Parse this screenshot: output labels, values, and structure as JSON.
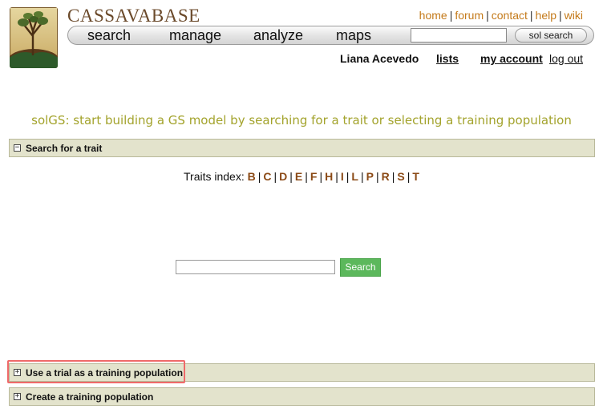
{
  "header": {
    "brand": "CASSAVABASE",
    "logo_icon": "cassava-tree-logo",
    "top_links": [
      "home",
      "forum",
      "contact",
      "help",
      "wiki"
    ],
    "nav_items": [
      "search",
      "manage",
      "analyze",
      "maps"
    ],
    "search_placeholder": "",
    "search_button": "sol search"
  },
  "user": {
    "name": "Liana Acevedo",
    "lists_label": "lists",
    "account_label": "my account",
    "logout_label": "log out"
  },
  "page": {
    "title": "solGS: start building a GS model by searching for a trait or selecting a training population"
  },
  "sections": {
    "trait_search": {
      "label": "Search for a trait",
      "toggle": "−"
    },
    "trial_population": {
      "label": "Use a trial as a training population",
      "toggle": "+"
    },
    "create_population": {
      "label": "Create a training population",
      "toggle": "+"
    }
  },
  "traits_index": {
    "label": "Traits index:",
    "letters": [
      "B",
      "C",
      "D",
      "E",
      "F",
      "H",
      "I",
      "L",
      "P",
      "R",
      "S",
      "T"
    ]
  },
  "trait_search": {
    "input_value": "",
    "button_label": "Search"
  },
  "colors": {
    "brand": "#6b4a2b",
    "link": "#c47a1a",
    "title": "#a3a32c",
    "section_bg": "#e3e3cc",
    "letter": "#8b4a16",
    "search_button": "#5cb85c",
    "highlight": "#ef6a6a"
  }
}
